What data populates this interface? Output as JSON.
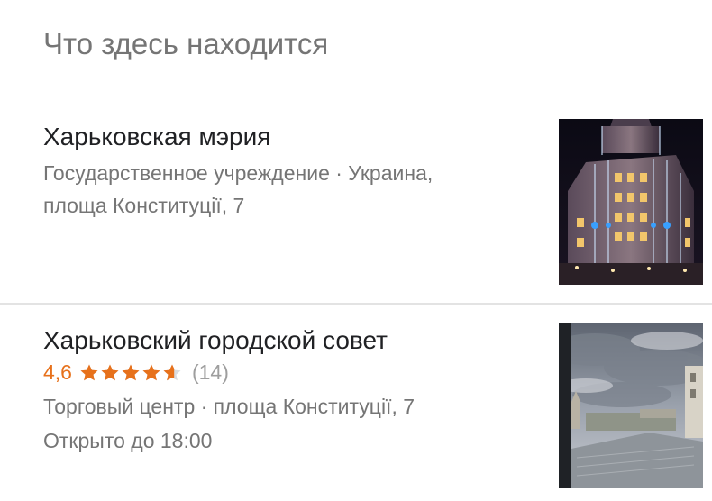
{
  "section": {
    "title": "Что здесь находится"
  },
  "places": [
    {
      "name": "Харьковская мэрия",
      "line1": "Государственное учреждение · Украина,",
      "line2": "площа Конституції, 7",
      "thumbnail_icon": "city-hall-night-photo"
    },
    {
      "name": "Харьковский городской совет",
      "rating": "4,6",
      "rating_stars": 4.6,
      "review_count": "(14)",
      "line1": "Торговый центр · площа Конституції, 7",
      "line2": "Открыто до 18:00",
      "thumbnail_icon": "cloudy-city-view-photo"
    }
  ],
  "colors": {
    "rating": "#e7711b",
    "secondary_text": "#757575",
    "primary_text": "#202124",
    "divider": "#e3e3e3"
  }
}
